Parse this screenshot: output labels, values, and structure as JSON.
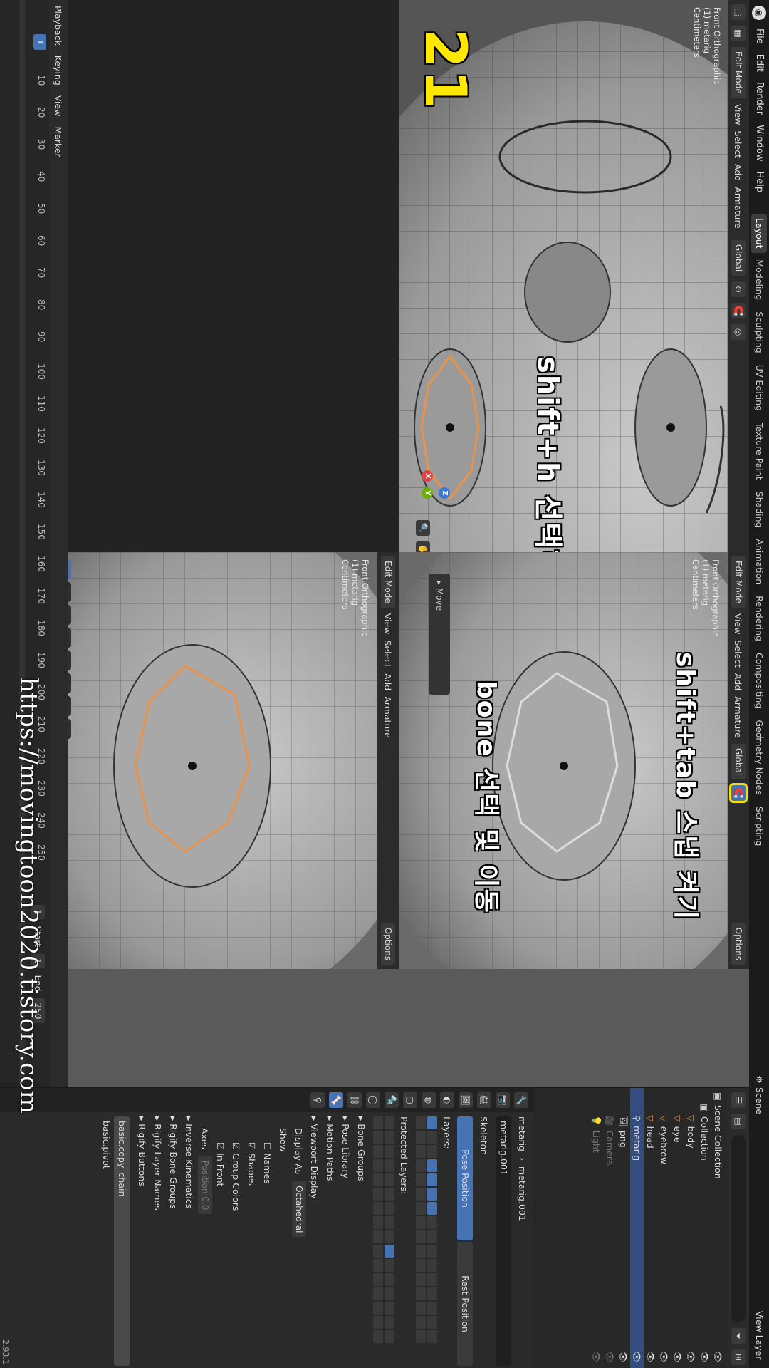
{
  "menu": [
    "File",
    "Edit",
    "Render",
    "Window",
    "Help"
  ],
  "workspaces": [
    "Layout",
    "Modeling",
    "Sculpting",
    "UV Editing",
    "Texture Paint",
    "Shading",
    "Animation",
    "Rendering",
    "Compositing",
    "Geometry Nodes",
    "Scripting"
  ],
  "active_workspace": "Layout",
  "scene": {
    "label": "Scene",
    "view_layer": "View Layer"
  },
  "viewport_header": {
    "mode": "Edit Mode",
    "view": "View",
    "select": "Select",
    "add": "Add",
    "armature": "Armature",
    "orientation": "Global",
    "options": "Options"
  },
  "viewport_info": {
    "line1": "Front Orthographic",
    "line2": "(1) metarig",
    "line3": "Centimeters"
  },
  "captions": {
    "top": "shift+h 선택하지 않은 bone 숨기기",
    "right_top": "shift+tab 스냅 켜기",
    "right_bottom": "bone 선택 및 이동"
  },
  "step_number": "21",
  "move_panel": "Move",
  "gizmo": {
    "x": "X",
    "y": "Y",
    "z": "Z"
  },
  "outliner": {
    "rows": [
      {
        "label": "Scene Collection",
        "depth": 0,
        "icon": "collection-icon"
      },
      {
        "label": "Collection",
        "depth": 1,
        "icon": "collection-icon"
      },
      {
        "label": "body",
        "depth": 2,
        "icon": "mesh-icon"
      },
      {
        "label": "eye",
        "depth": 2,
        "icon": "mesh-icon"
      },
      {
        "label": "eyebrow",
        "depth": 2,
        "icon": "mesh-icon"
      },
      {
        "label": "head",
        "depth": 2,
        "icon": "mesh-icon"
      },
      {
        "label": "metarig",
        "depth": 2,
        "icon": "armature-icon",
        "selected": true
      },
      {
        "label": "png",
        "depth": 2,
        "icon": "image-icon"
      },
      {
        "label": "Camera",
        "depth": 2,
        "icon": "camera-icon",
        "dim": true
      },
      {
        "label": "Light",
        "depth": 2,
        "icon": "light-icon",
        "dim": true
      }
    ]
  },
  "properties": {
    "breadcrumb_left": "metarig",
    "breadcrumb_right": "metarig.001",
    "name_field": "metarig.001",
    "skeleton": "Skeleton",
    "pose_position": "Pose Position",
    "rest_position": "Rest Position",
    "layers": "Layers:",
    "protected_layers": "Protected Layers:",
    "sections": [
      "Bone Groups",
      "Pose Library",
      "Motion Paths",
      "Viewport Display"
    ],
    "display_as_label": "Display As",
    "display_as_value": "Octahedral",
    "show_label": "Show",
    "show_names": "Names",
    "show_shapes": "Shapes",
    "show_group_colors": "Group Colors",
    "show_in_front": "In Front",
    "axes_label": "Axes",
    "position_label": "Position",
    "position_value": "0.0",
    "more_sections": [
      "Inverse Kinematics",
      "Rigify Bone Groups",
      "Rigify Layer Names",
      "Rigify Buttons"
    ],
    "sample_field": "basic.copy_chain",
    "sample_option": "basic.pivot"
  },
  "timeline": {
    "menu": [
      "Playback",
      "Keying",
      "View",
      "Marker"
    ],
    "ticks": [
      "1",
      "10",
      "20",
      "30",
      "40",
      "50",
      "60",
      "70",
      "80",
      "90",
      "100",
      "110",
      "120",
      "130",
      "140",
      "150",
      "160",
      "170",
      "180",
      "190",
      "200",
      "210",
      "220",
      "230",
      "240",
      "250"
    ],
    "current_frame": "1",
    "start_label": "Start",
    "start_value": "1",
    "end_label": "End",
    "end_value": "250"
  },
  "watermark": "https://movingtoon2020.tistory.com",
  "version": "2.93.1",
  "colors": {
    "bone_selected": "#e8924a",
    "accent": "#4772b3",
    "highlight_box": "#f5e000"
  }
}
